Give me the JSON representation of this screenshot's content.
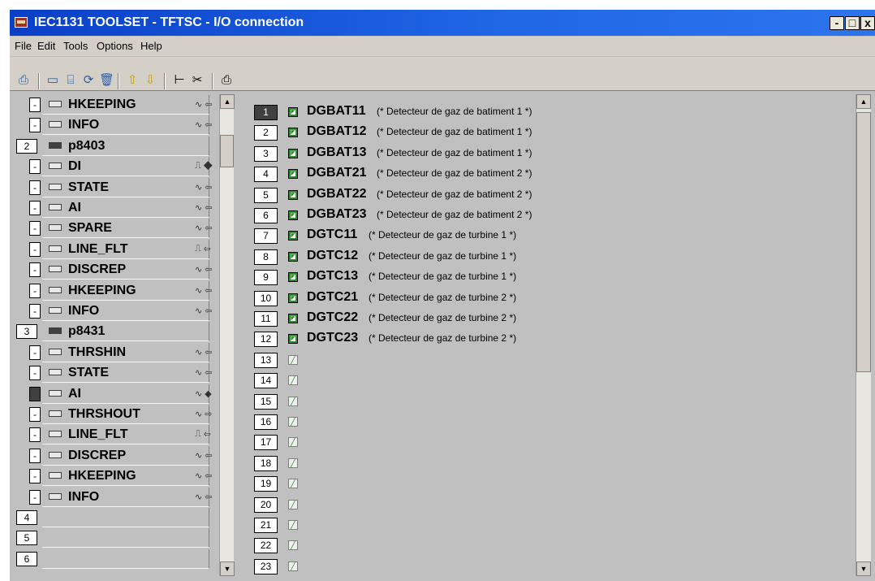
{
  "window": {
    "title": "IEC1131 TOOLSET - TFTSC - I/O connection",
    "minimize_glyph": "-",
    "maximize_glyph": "□",
    "close_glyph": "x"
  },
  "menu": [
    "File",
    "Edit",
    "Tools",
    "Options",
    "Help"
  ],
  "toolbar_icons": [
    "print-preview-icon",
    "insert-board-icon",
    "connect-icon",
    "refresh-icon",
    "delete-icon",
    "move-up-icon",
    "move-down-icon",
    "tree-icon",
    "cut-icon",
    "print-icon"
  ],
  "left_rows": [
    {
      "num": "-",
      "name": "HKEEPING",
      "sym": "∿ ⇦",
      "indent": true
    },
    {
      "num": "-",
      "name": "INFO",
      "sym": "∿ ⇦",
      "indent": true
    },
    {
      "num": "2",
      "name": "p8403",
      "sym": "",
      "indent": false
    },
    {
      "num": "-",
      "name": "DI",
      "sym": "⎍ ◆",
      "indent": true
    },
    {
      "num": "-",
      "name": "STATE",
      "sym": "∿ ⇦",
      "indent": true
    },
    {
      "num": "-",
      "name": "AI",
      "sym": "∿ ⇦",
      "indent": true
    },
    {
      "num": "-",
      "name": "SPARE",
      "sym": "∿ ⇦",
      "indent": true
    },
    {
      "num": "-",
      "name": "LINE_FLT",
      "sym": "⎍ ⇦",
      "indent": true
    },
    {
      "num": "-",
      "name": "DISCREP",
      "sym": "∿ ⇦",
      "indent": true
    },
    {
      "num": "-",
      "name": "HKEEPING",
      "sym": "∿ ⇦",
      "indent": true
    },
    {
      "num": "-",
      "name": "INFO",
      "sym": "∿ ⇦",
      "indent": true
    },
    {
      "num": "3",
      "name": "p8431",
      "sym": "",
      "indent": false
    },
    {
      "num": "-",
      "name": "THRSHIN",
      "sym": "∿ ⇦",
      "indent": true
    },
    {
      "num": "-",
      "name": "STATE",
      "sym": "∿ ⇦",
      "indent": true
    },
    {
      "num": "-",
      "name": "AI",
      "sym": "∿ ◆",
      "indent": true,
      "selected": true
    },
    {
      "num": "-",
      "name": "THRSHOUT",
      "sym": "∿ ⇨",
      "indent": true
    },
    {
      "num": "-",
      "name": "LINE_FLT",
      "sym": "⎍ ⇦",
      "indent": true
    },
    {
      "num": "-",
      "name": "DISCREP",
      "sym": "∿ ⇦",
      "indent": true
    },
    {
      "num": "-",
      "name": "HKEEPING",
      "sym": "∿ ⇦",
      "indent": true
    },
    {
      "num": "-",
      "name": "INFO",
      "sym": "∿ ⇦",
      "indent": true
    },
    {
      "num": "4",
      "name": "",
      "sym": "",
      "indent": false
    },
    {
      "num": "5",
      "name": "",
      "sym": "",
      "indent": false
    },
    {
      "num": "6",
      "name": "",
      "sym": "",
      "indent": false
    }
  ],
  "right_rows": [
    {
      "num": "1",
      "name": "DGBAT11",
      "comment": "(* Detecteur de gaz de batiment 1 *)"
    },
    {
      "num": "2",
      "name": "DGBAT12",
      "comment": "(* Detecteur de gaz de batiment 1 *)"
    },
    {
      "num": "3",
      "name": "DGBAT13",
      "comment": "(* Detecteur de gaz de batiment 1 *)"
    },
    {
      "num": "4",
      "name": "DGBAT21",
      "comment": "(* Detecteur de gaz de batiment 2 *)"
    },
    {
      "num": "5",
      "name": "DGBAT22",
      "comment": "(* Detecteur de gaz de batiment 2 *)"
    },
    {
      "num": "6",
      "name": "DGBAT23",
      "comment": "(* Detecteur de gaz de batiment 2 *)"
    },
    {
      "num": "7",
      "name": "DGTC11",
      "comment": "(* Detecteur de gaz de turbine 1 *)"
    },
    {
      "num": "8",
      "name": "DGTC12",
      "comment": "(* Detecteur de gaz de turbine 1 *)"
    },
    {
      "num": "9",
      "name": "DGTC13",
      "comment": "(* Detecteur de gaz de turbine 1 *)"
    },
    {
      "num": "10",
      "name": "DGTC21",
      "comment": "(* Detecteur de gaz de turbine 2 *)"
    },
    {
      "num": "11",
      "name": "DGTC22",
      "comment": "(* Detecteur de gaz de turbine 2 *)"
    },
    {
      "num": "12",
      "name": "DGTC23",
      "comment": "(* Detecteur de gaz de turbine 2 *)"
    },
    {
      "num": "13",
      "name": "",
      "comment": ""
    },
    {
      "num": "14",
      "name": "",
      "comment": ""
    },
    {
      "num": "15",
      "name": "",
      "comment": ""
    },
    {
      "num": "16",
      "name": "",
      "comment": ""
    },
    {
      "num": "17",
      "name": "",
      "comment": ""
    },
    {
      "num": "18",
      "name": "",
      "comment": ""
    },
    {
      "num": "19",
      "name": "",
      "comment": ""
    },
    {
      "num": "20",
      "name": "",
      "comment": ""
    },
    {
      "num": "21",
      "name": "",
      "comment": ""
    },
    {
      "num": "22",
      "name": "",
      "comment": ""
    },
    {
      "num": "23",
      "name": "",
      "comment": ""
    }
  ],
  "scroll_glyphs": {
    "up": "▲",
    "down": "▼"
  },
  "colors": {
    "titlebar": "#1f5fe0",
    "workspace": "#c0c0c0",
    "variable_icon": "#2a8a2a"
  }
}
